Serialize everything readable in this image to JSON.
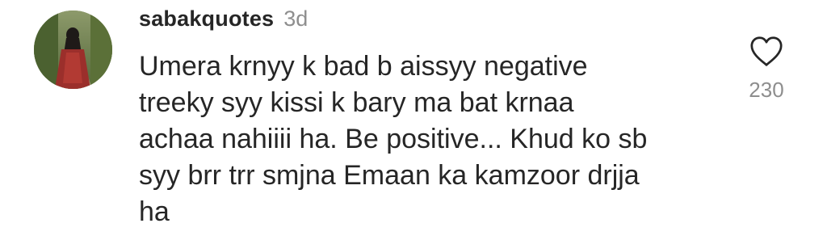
{
  "comment": {
    "username": "sabakquotes",
    "time": "3d",
    "text": "Umera krnyy k bad b aissyy negative\ntreeky syy kissi k bary ma bat krnaa\nachaa nahiiii ha. Be positive... Khud ko sb\nsyy brr trr smjna Emaan ka kamzoor drjja\nha",
    "like_count": "230",
    "like_icon": "heart-outline-icon"
  },
  "colors": {
    "text_primary": "#262626",
    "text_secondary": "#8e8e8e",
    "background": "#ffffff"
  }
}
